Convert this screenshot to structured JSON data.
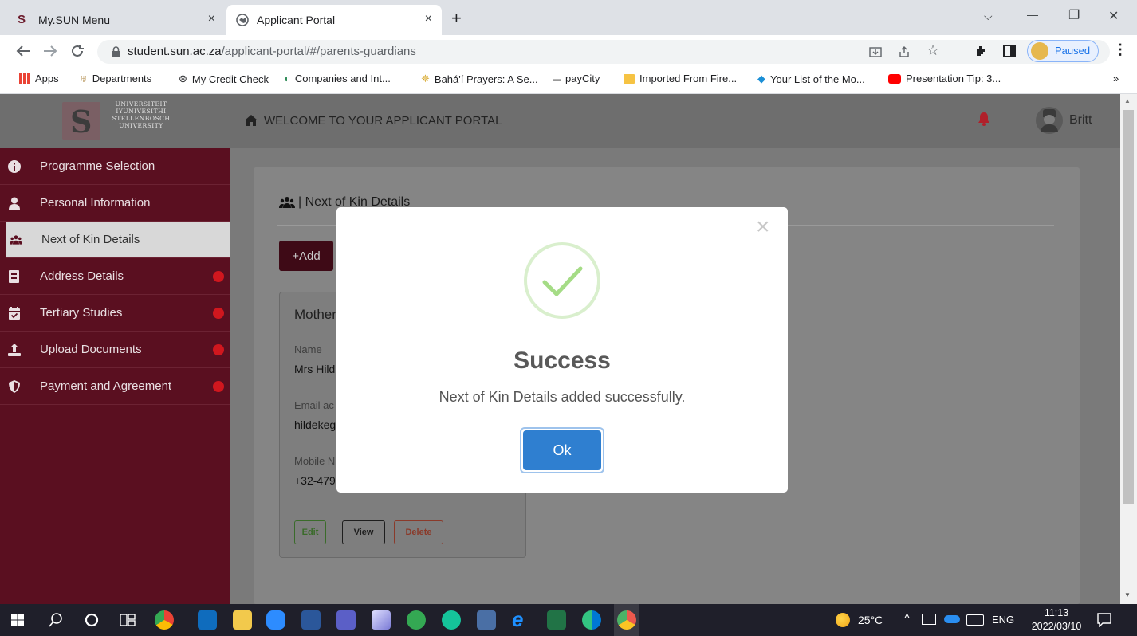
{
  "browser": {
    "tabs": [
      {
        "title": "My.SUN Menu",
        "close": "×"
      },
      {
        "title": "Applicant Portal",
        "close": "×"
      }
    ],
    "new_tab": "+",
    "window_controls": {
      "minimize": "—",
      "restore": "❐",
      "close": "✕",
      "tab_list": "⌵"
    },
    "url_host": "student.sun.ac.za",
    "url_path": "/applicant-portal/#/parents-guardians",
    "profile_status": "Paused",
    "bookmarks": [
      "Apps",
      "Departments",
      "My Credit Check",
      "Companies and Int...",
      "Bahá'í Prayers: A Se...",
      "payCity",
      "Imported From Fire...",
      "Your List of the Mo...",
      "Presentation Tip: 3..."
    ],
    "bookmarks_more": "»"
  },
  "portal": {
    "logo_lines": [
      "UNIVERSITEIT",
      "IYUNIVESITHI",
      "STELLENBOSCH",
      "UNIVERSITY"
    ],
    "header_title": "WELCOME TO YOUR APPLICANT PORTAL",
    "user_name": "Britt",
    "sidebar": [
      {
        "label": "Programme Selection",
        "icon": "info-icon",
        "dot": false
      },
      {
        "label": "Personal Information",
        "icon": "user-icon",
        "dot": false
      },
      {
        "label": "Next of Kin Details",
        "icon": "users-icon",
        "dot": false,
        "active": true
      },
      {
        "label": "Address Details",
        "icon": "address-book-icon",
        "dot": true
      },
      {
        "label": "Tertiary Studies",
        "icon": "calendar-icon",
        "dot": true
      },
      {
        "label": "Upload Documents",
        "icon": "upload-icon",
        "dot": true
      },
      {
        "label": "Payment and Agreement",
        "icon": "shield-icon",
        "dot": true
      }
    ],
    "section_title": "Next of Kin Details",
    "add_button": "+Add",
    "kin_card": {
      "title": "Mother'",
      "name_label": "Name",
      "name_value": "Mrs Hild",
      "email_label": "Email ac",
      "email_value": "hildekeg",
      "mobile_label": "Mobile N",
      "mobile_value": "+32-479",
      "edit": "Edit",
      "view": "View",
      "delete": "Delete"
    }
  },
  "modal": {
    "close": "×",
    "title": "Success",
    "message": "Next of Kin Details added successfully.",
    "ok": "Ok"
  },
  "taskbar": {
    "temperature": "25°C",
    "language": "ENG",
    "time": "11:13",
    "date": "2022/03/10"
  },
  "colors": {
    "sidebar": "#5a0f20",
    "primary_button": "#5a0f20",
    "ok_button": "#2f7fd0",
    "success": "#a5dc86",
    "status_dot": "#d0171e"
  }
}
